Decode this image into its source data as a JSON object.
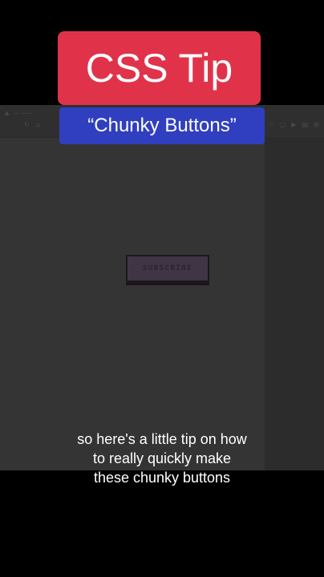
{
  "overlay": {
    "title": "CSS Tip",
    "subtitle": "“Chunky Buttons”",
    "caption_lines": [
      "so here's a little tip on how",
      "to really quickly make",
      "these chunky buttons"
    ]
  },
  "demo": {
    "button_label": "SUBSCRIBE"
  },
  "colors": {
    "title_bg": "#e0334a",
    "subtitle_bg": "#2f3fbf",
    "page_bg": "#000000",
    "button_bg": "#3f3544"
  }
}
